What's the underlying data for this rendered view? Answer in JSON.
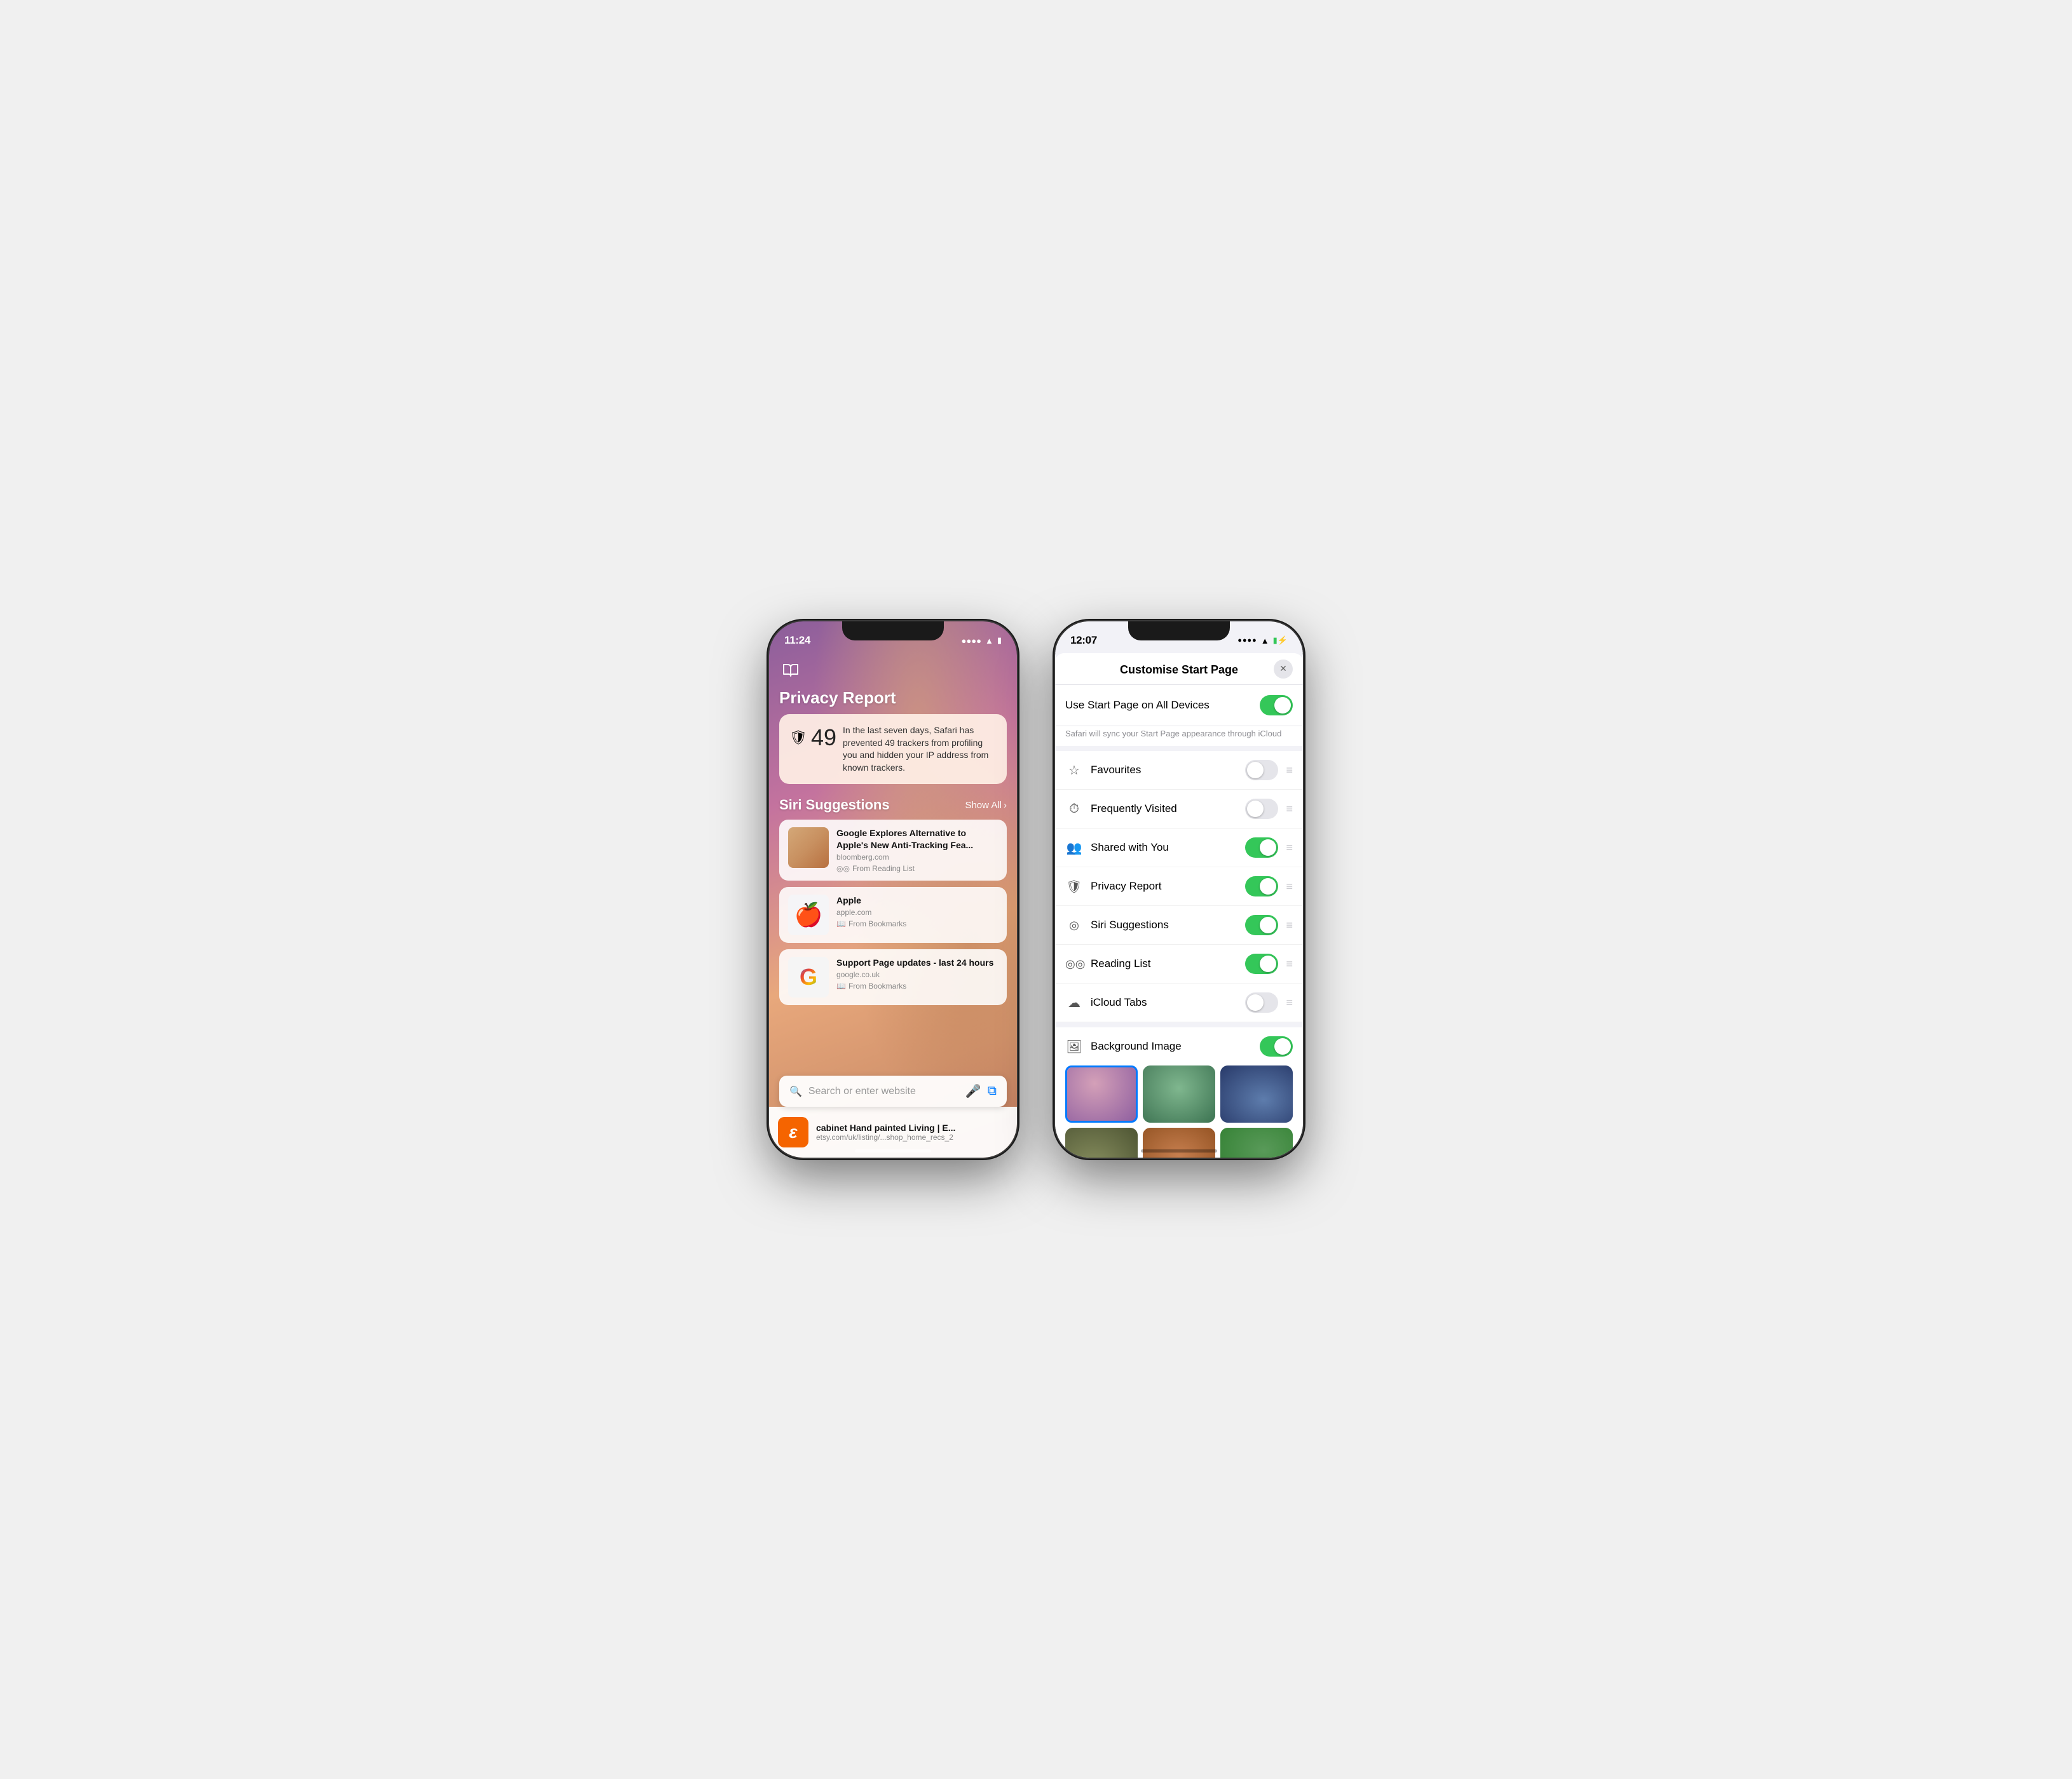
{
  "phone1": {
    "status": {
      "time": "11:24",
      "signal": "●●●●",
      "wifi": "WiFi",
      "battery": "🔋"
    },
    "book_icon": "📖",
    "privacy_report": {
      "title": "Privacy Report",
      "card_text": "In the last seven days, Safari has prevented 49 trackers from profiling you and hidden your IP address from known trackers.",
      "tracker_count": "49",
      "tracker_icon": "🛡"
    },
    "siri_suggestions": {
      "title": "Siri Suggestions",
      "show_all": "Show All",
      "items": [
        {
          "title": "Google Explores Alternative to Apple's New Anti-Tracking Fea...",
          "url": "bloomberg.com",
          "source": "From Reading List"
        },
        {
          "title": "Apple",
          "url": "apple.com",
          "source": "From Bookmarks"
        },
        {
          "title": "Support Page updates - last 24 hours",
          "url": "google.co.uk",
          "source": "From Bookmarks"
        }
      ]
    },
    "search_bar": {
      "placeholder": "Search or enter website"
    },
    "bottom_item": {
      "title": "cabinet Hand painted Living | E...",
      "url": "etsy.com/uk/listing/...shop_home_recs_2"
    }
  },
  "phone2": {
    "status": {
      "time": "12:07",
      "signal": "●●●●",
      "wifi": "WiFi",
      "battery": "🔋"
    },
    "sheet": {
      "title": "Customise Start Page",
      "close_label": "✕",
      "sync_row": {
        "label": "Use Start Page on All Devices",
        "toggle": "on",
        "sublabel": "Safari will sync your Start Page appearance through iCloud"
      },
      "rows": [
        {
          "icon": "☆",
          "label": "Favourites",
          "toggle": "off"
        },
        {
          "icon": "⏱",
          "label": "Frequently Visited",
          "toggle": "off"
        },
        {
          "icon": "👥",
          "label": "Shared with You",
          "toggle": "on"
        },
        {
          "icon": "🛡",
          "label": "Privacy Report",
          "toggle": "on"
        },
        {
          "icon": "◎",
          "label": "Siri Suggestions",
          "toggle": "on"
        },
        {
          "icon": "◎",
          "label": "Reading List",
          "toggle": "on"
        },
        {
          "icon": "☁",
          "label": "iCloud Tabs",
          "toggle": "off"
        }
      ],
      "background_image": {
        "label": "Background Image",
        "toggle": "on",
        "icon": "🖼"
      }
    }
  }
}
